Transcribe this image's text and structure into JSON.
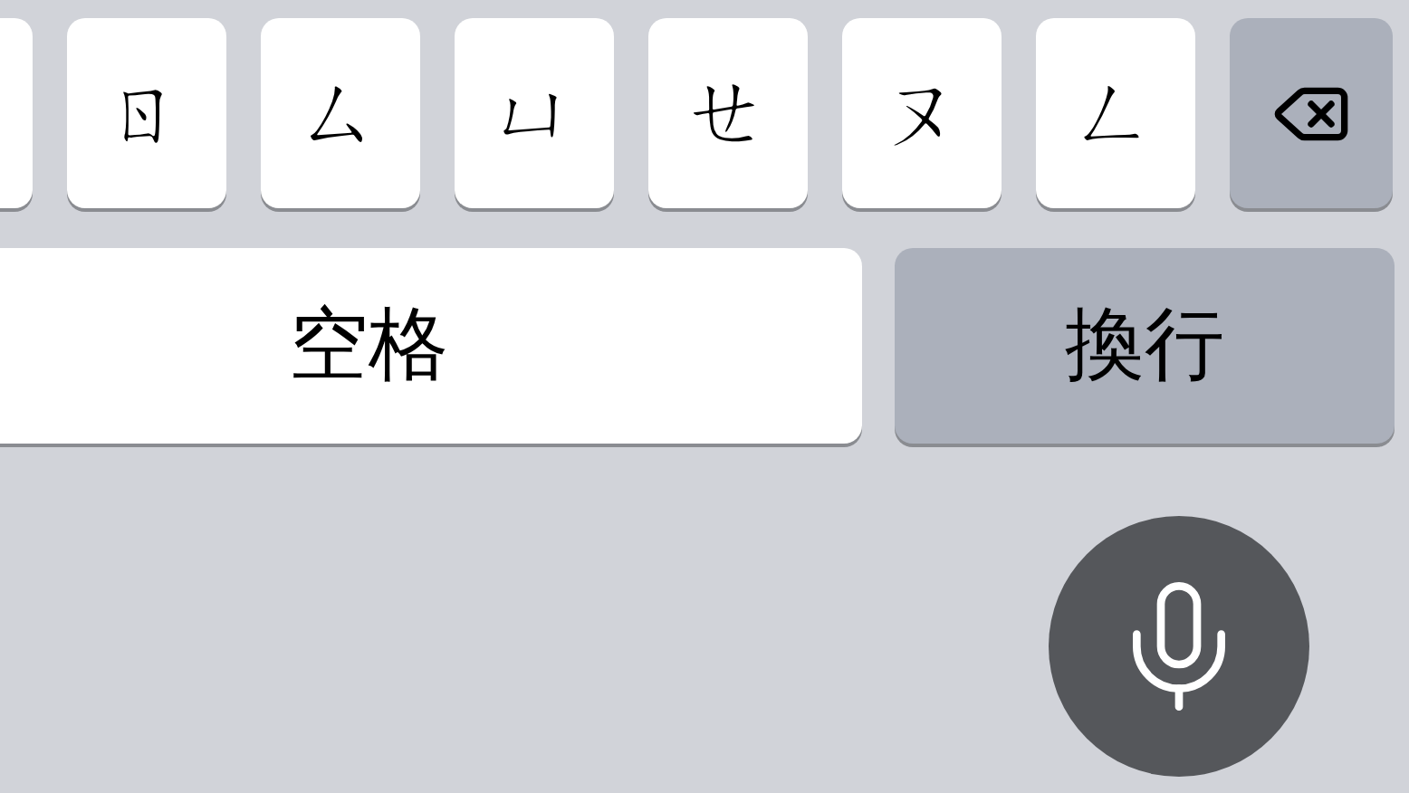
{
  "rows": [
    {
      "keys": [
        {
          "kind": "partial"
        },
        {
          "kind": "char",
          "label": "ㄖ"
        },
        {
          "kind": "char",
          "label": "ㄙ"
        },
        {
          "kind": "char",
          "label": "ㄩ"
        },
        {
          "kind": "char",
          "label": "ㄝ"
        },
        {
          "kind": "char",
          "label": "ㄡ"
        },
        {
          "kind": "char",
          "label": "ㄥ"
        },
        {
          "kind": "delete"
        }
      ]
    },
    {
      "keys": [
        {
          "kind": "space",
          "label": "空格"
        },
        {
          "kind": "return",
          "label": "換行"
        }
      ]
    }
  ]
}
